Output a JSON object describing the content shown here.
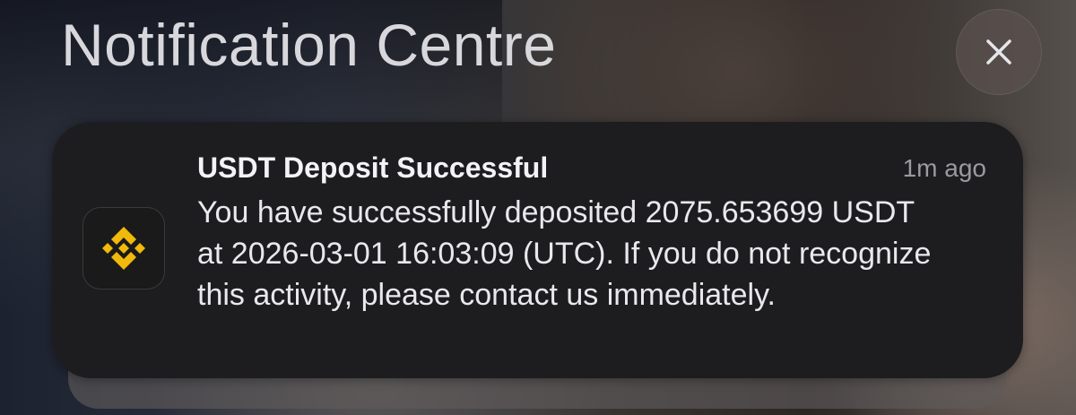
{
  "header": {
    "title": "Notification Centre",
    "close_icon": "close-icon"
  },
  "notification": {
    "app_icon": "binance-logo-icon",
    "title": "USDT Deposit Successful",
    "time": "1m ago",
    "body": "You have successfully deposited 2075.653699 USDT at 2026-03-01 16:03:09 (UTC). If you do not recognize this activity, please contact us immediately."
  },
  "colors": {
    "card_background": "#1d1d1f",
    "brand_accent": "#f0b90b"
  }
}
